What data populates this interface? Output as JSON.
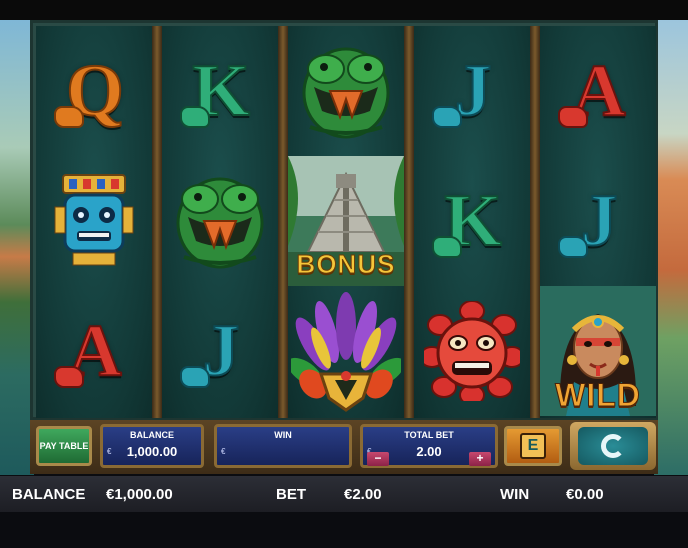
{
  "reels": [
    [
      {
        "symbol": "letter",
        "text": "Q",
        "kind": "q"
      },
      {
        "symbol": "mask-blue",
        "icon": "blue-tiki-mask-icon"
      },
      {
        "symbol": "letter",
        "text": "A",
        "kind": "a"
      }
    ],
    [
      {
        "symbol": "letter",
        "text": "K",
        "kind": "k"
      },
      {
        "symbol": "serpent",
        "icon": "green-serpent-icon"
      },
      {
        "symbol": "letter",
        "text": "J",
        "kind": "j"
      }
    ],
    [
      {
        "symbol": "serpent",
        "icon": "green-serpent-icon"
      },
      {
        "symbol": "bonus",
        "text": "BONUS",
        "icon": "pyramid-icon"
      },
      {
        "symbol": "headdress",
        "icon": "feather-headdress-icon"
      }
    ],
    [
      {
        "symbol": "letter",
        "text": "J",
        "kind": "j"
      },
      {
        "symbol": "letter",
        "text": "K",
        "kind": "k"
      },
      {
        "symbol": "mask-red",
        "icon": "red-flower-mask-icon"
      }
    ],
    [
      {
        "symbol": "letter",
        "text": "A",
        "kind": "a"
      },
      {
        "symbol": "letter",
        "text": "J",
        "kind": "j"
      },
      {
        "symbol": "wild",
        "text": "WILD",
        "icon": "wild-woman-icon"
      }
    ]
  ],
  "controls": {
    "paytable_label": "PAY TABLE",
    "balance_label": "BALANCE",
    "balance_currency": "€",
    "balance_value": "1,000.00",
    "win_label": "WIN",
    "win_currency": "€",
    "win_value": "",
    "totalbet_label": "TOTAL BET",
    "totalbet_currency": "€",
    "totalbet_value": "2.00",
    "minus_label": "−",
    "plus_label": "+",
    "e_button_label": "E"
  },
  "status": {
    "balance_label": "BALANCE",
    "balance_value": "€1,000.00",
    "bet_label": "BET",
    "bet_value": "€2.00",
    "win_label": "WIN",
    "win_value": "€0.00"
  },
  "colors": {
    "reel_bg": "#123937",
    "gold": "#f5c63a",
    "q_orange": "#e07a1f",
    "k_green": "#2fae79",
    "j_teal": "#2aa3b5",
    "a_red": "#d8382e"
  }
}
